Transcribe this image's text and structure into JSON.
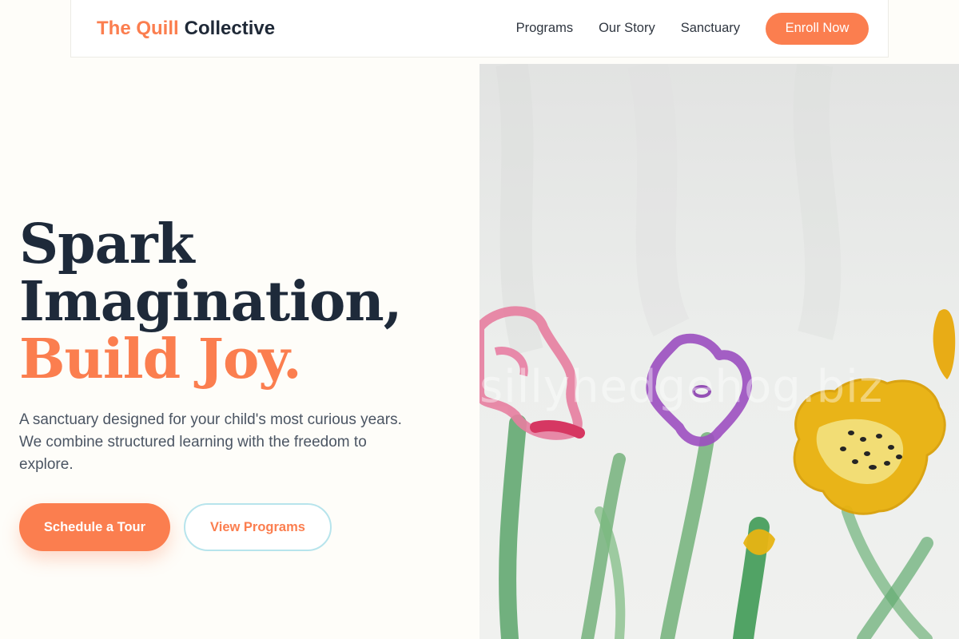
{
  "nav": {
    "brand_accent": "The Quill",
    "brand_main": "Collective",
    "links": [
      "Programs",
      "Our Story",
      "Sanctuary"
    ],
    "cta": "Enroll Now"
  },
  "hero": {
    "headline": [
      "Spark",
      "Imagination,",
      "Build Joy."
    ],
    "subtext": "A sanctuary designed for your child's most curious years. We combine structured learning with the freedom to explore.",
    "primary_cta": "Schedule a Tour",
    "secondary_cta": "View Programs"
  },
  "image": {
    "watermark": "sillyhedgehog.biz"
  },
  "colors": {
    "accent": "#fb7e4f",
    "heading": "#1e2a3a",
    "outline": "#b7e4ec"
  }
}
